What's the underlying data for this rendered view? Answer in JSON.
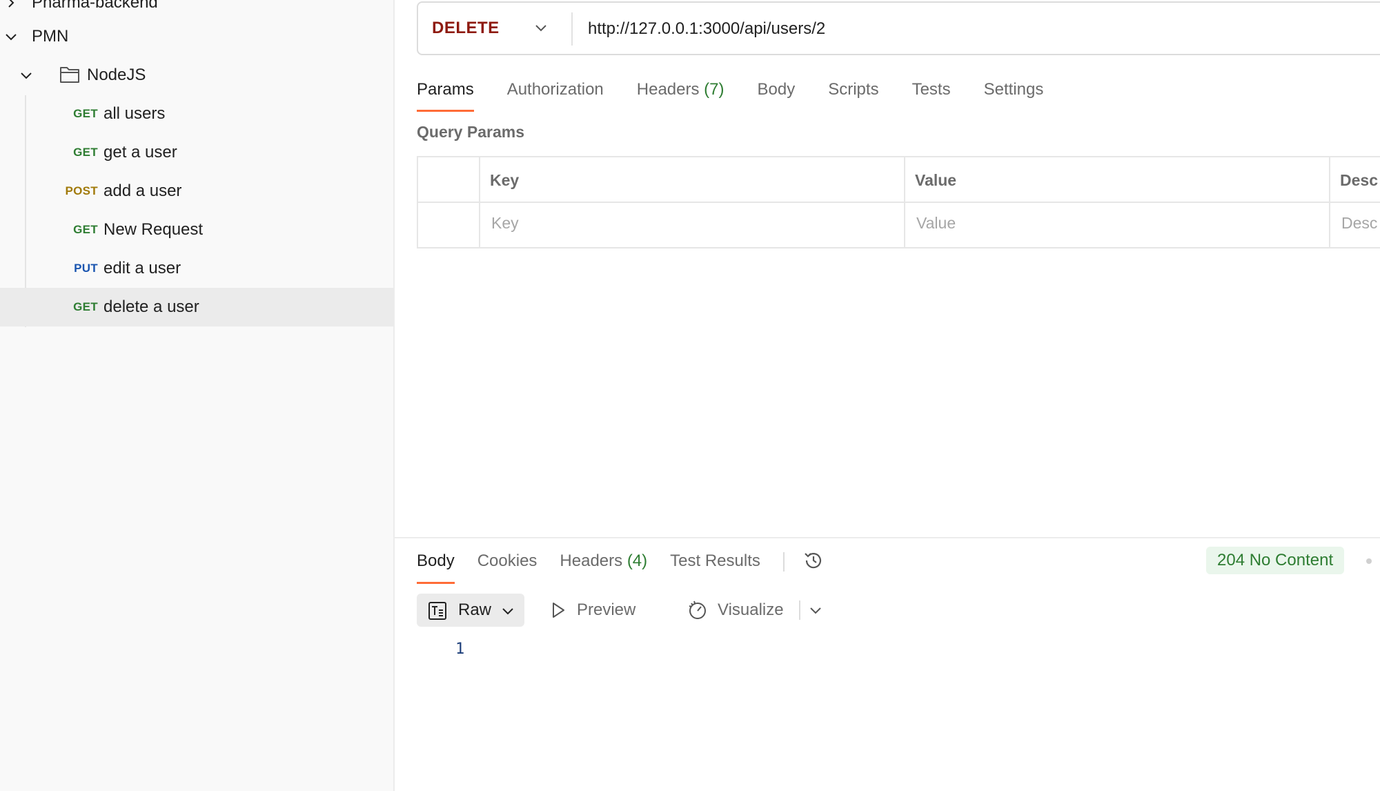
{
  "sidebar": {
    "partial_collection_label": "Pharma-backend",
    "collection": {
      "label": "PMN"
    },
    "folder": {
      "label": "NodeJS"
    },
    "requests": [
      {
        "method": "GET",
        "name": "all users"
      },
      {
        "method": "GET",
        "name": "get a user"
      },
      {
        "method": "POST",
        "name": "add a user"
      },
      {
        "method": "GET",
        "name": "New Request"
      },
      {
        "method": "PUT",
        "name": "edit a user"
      },
      {
        "method": "GET",
        "name": "delete a user"
      }
    ],
    "selected_request": "delete a user"
  },
  "request": {
    "method": "DELETE",
    "url": "http://127.0.0.1:3000/api/users/2",
    "tabs": [
      {
        "label": "Params"
      },
      {
        "label": "Authorization"
      },
      {
        "label": "Headers",
        "count": "(7)"
      },
      {
        "label": "Body"
      },
      {
        "label": "Scripts"
      },
      {
        "label": "Tests"
      },
      {
        "label": "Settings"
      }
    ],
    "active_tab": "Params",
    "query_params": {
      "title": "Query Params",
      "headers": {
        "key": "Key",
        "value": "Value",
        "description": "Desc"
      },
      "placeholders": {
        "key": "Key",
        "value": "Value",
        "description": "Desc"
      }
    }
  },
  "response": {
    "tabs": [
      {
        "label": "Body"
      },
      {
        "label": "Cookies"
      },
      {
        "label": "Headers",
        "count": "(4)"
      },
      {
        "label": "Test Results"
      }
    ],
    "active_tab": "Body",
    "status": "204 No Content",
    "toolbar": {
      "format": "Raw",
      "preview": "Preview",
      "visualize": "Visualize"
    },
    "body_lines": [
      "1"
    ]
  },
  "colors": {
    "accent": "#ff6c37",
    "get": "#2e7d32",
    "post": "#a17a0a",
    "put": "#1a55b0",
    "delete": "#8e1a10",
    "status_ok": "#2e7d32"
  }
}
